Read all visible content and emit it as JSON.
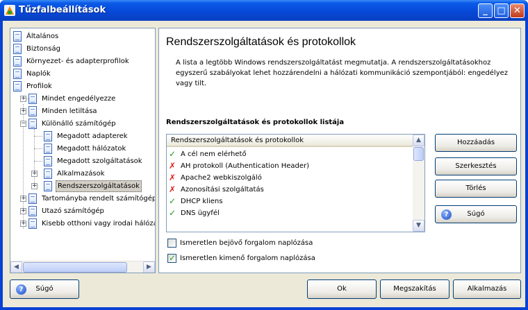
{
  "window": {
    "title": "Tűzfalbeállítások"
  },
  "tree": {
    "items": [
      {
        "label": "Általános"
      },
      {
        "label": "Biztonság"
      },
      {
        "label": "Környezet- és adapterprofilok"
      },
      {
        "label": "Naplók"
      },
      {
        "label": "Profilok"
      },
      {
        "label": "Mindet engedélyezze"
      },
      {
        "label": "Minden letiltása"
      },
      {
        "label": "Különálló számítógép"
      },
      {
        "label": "Megadott adapterek"
      },
      {
        "label": "Megadott hálózatok"
      },
      {
        "label": "Megadott szolgáltatások"
      },
      {
        "label": "Alkalmazások"
      },
      {
        "label": "Rendszerszolgáltatások"
      },
      {
        "label": "Tartományba rendelt számítógép"
      },
      {
        "label": "Utazó számítógép"
      },
      {
        "label": "Kisebb otthoni vagy irodai hálózat"
      }
    ]
  },
  "panel": {
    "title": "Rendszerszolgáltatások és protokollok",
    "description": "A lista a legtöbb Windows rendszerszolgáltatást megmutatja. A rendszerszolgáltatásokhoz egyszerű szabályokat lehet hozzárendelni a hálózati kommunikáció szempontjából: engedélyez vagy tilt.",
    "list_title": "Rendszerszolgáltatások és protokollok listája",
    "list": {
      "header": "Rendszerszolgáltatások és protokollok",
      "rows": [
        {
          "label": "A cél nem elérhető",
          "allowed": true
        },
        {
          "label": "AH protokoll (Authentication Header)",
          "allowed": false
        },
        {
          "label": "Apache2 webkiszolgáló",
          "allowed": false
        },
        {
          "label": "Azonosítási szolgáltatás",
          "allowed": false
        },
        {
          "label": "DHCP kliens",
          "allowed": true
        },
        {
          "label": "DNS ügyfél",
          "allowed": true
        }
      ]
    },
    "buttons": {
      "add": "Hozzáadás",
      "edit": "Szerkesztés",
      "delete": "Törlés",
      "help": "Súgó"
    },
    "checkboxes": [
      {
        "label": "Ismeretlen bejövő forgalom naplózása",
        "checked": false
      },
      {
        "label": "Ismeretlen kimenő forgalom naplózása",
        "checked": true
      }
    ]
  },
  "footer": {
    "help": "Súgó",
    "ok": "Ok",
    "cancel": "Megszakítás",
    "apply": "Alkalmazás"
  }
}
